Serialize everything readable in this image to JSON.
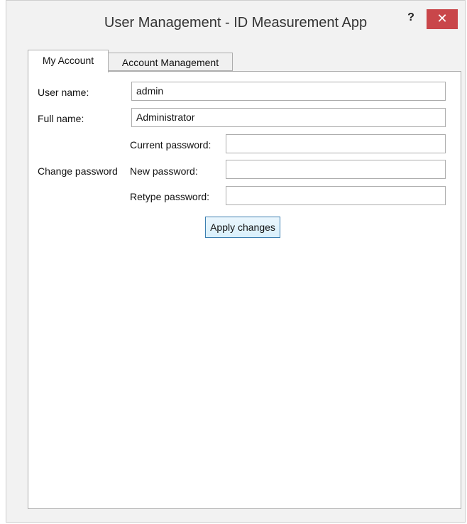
{
  "window": {
    "title": "User Management - ID Measurement App",
    "help_glyph": "?",
    "close_glyph": "✕",
    "close_color": "#c9464a"
  },
  "tabs": [
    {
      "label": "My Account",
      "selected": true
    },
    {
      "label": "Account Management",
      "selected": false
    }
  ],
  "form": {
    "username_label": "User name:",
    "username_value": "admin",
    "fullname_label": "Full name:",
    "fullname_value": "Administrator",
    "change_password_label": "Change password",
    "current_password_label": "Current password:",
    "current_password_value": "",
    "new_password_label": "New password:",
    "new_password_value": "",
    "retype_password_label": "Retype password:",
    "retype_password_value": "",
    "apply_label": "Apply changes"
  }
}
